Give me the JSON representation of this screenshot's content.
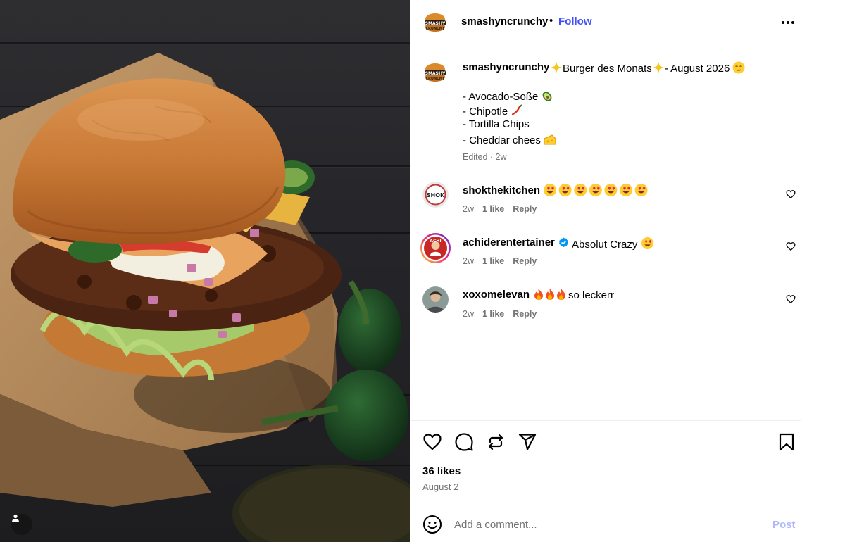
{
  "post": {
    "username": "smashyncrunchy",
    "follow_label": "Follow",
    "separator": "•",
    "logo_text_top": "SMASHY",
    "logo_text_bottom": "CRUNCHY"
  },
  "caption": {
    "username": "smashyncrunchy",
    "title_main": "Burger des Monats",
    "title_suffix": "- August 2026",
    "lines": [
      "- Avocado-Soße",
      "- Chipotle",
      "- Tortilla Chips",
      "- Cheddar chees"
    ],
    "meta": "Edited · 2w"
  },
  "comments": [
    {
      "username": "shokthekitchen",
      "text": "",
      "time": "2w",
      "likes": "1 like",
      "reply": "Reply",
      "emoji_count": 7
    },
    {
      "username": "achiderentertainer",
      "text": "Absolut Crazy",
      "time": "2w",
      "likes": "1 like",
      "reply": "Reply",
      "verified": true
    },
    {
      "username": "xoxomelevan",
      "text": "so leckerr",
      "time": "2w",
      "likes": "1 like",
      "reply": "Reply"
    }
  ],
  "stats": {
    "likes": "36 likes",
    "date": "August 2"
  },
  "comment_box": {
    "placeholder": "Add a comment...",
    "post_label": "Post"
  },
  "icons": {
    "like": "heart-icon",
    "comment": "speech-bubble-icon",
    "repost": "repost-icon",
    "share": "paper-plane-icon",
    "save": "bookmark-icon",
    "emoji": "smiley-icon",
    "more": "ellipsis-icon",
    "verified": "verified-badge-icon"
  },
  "colors": {
    "follow": "#4150f7",
    "post_disabled": "#b2b7fc",
    "secondary_text": "#737373",
    "verified": "#0095f6"
  }
}
